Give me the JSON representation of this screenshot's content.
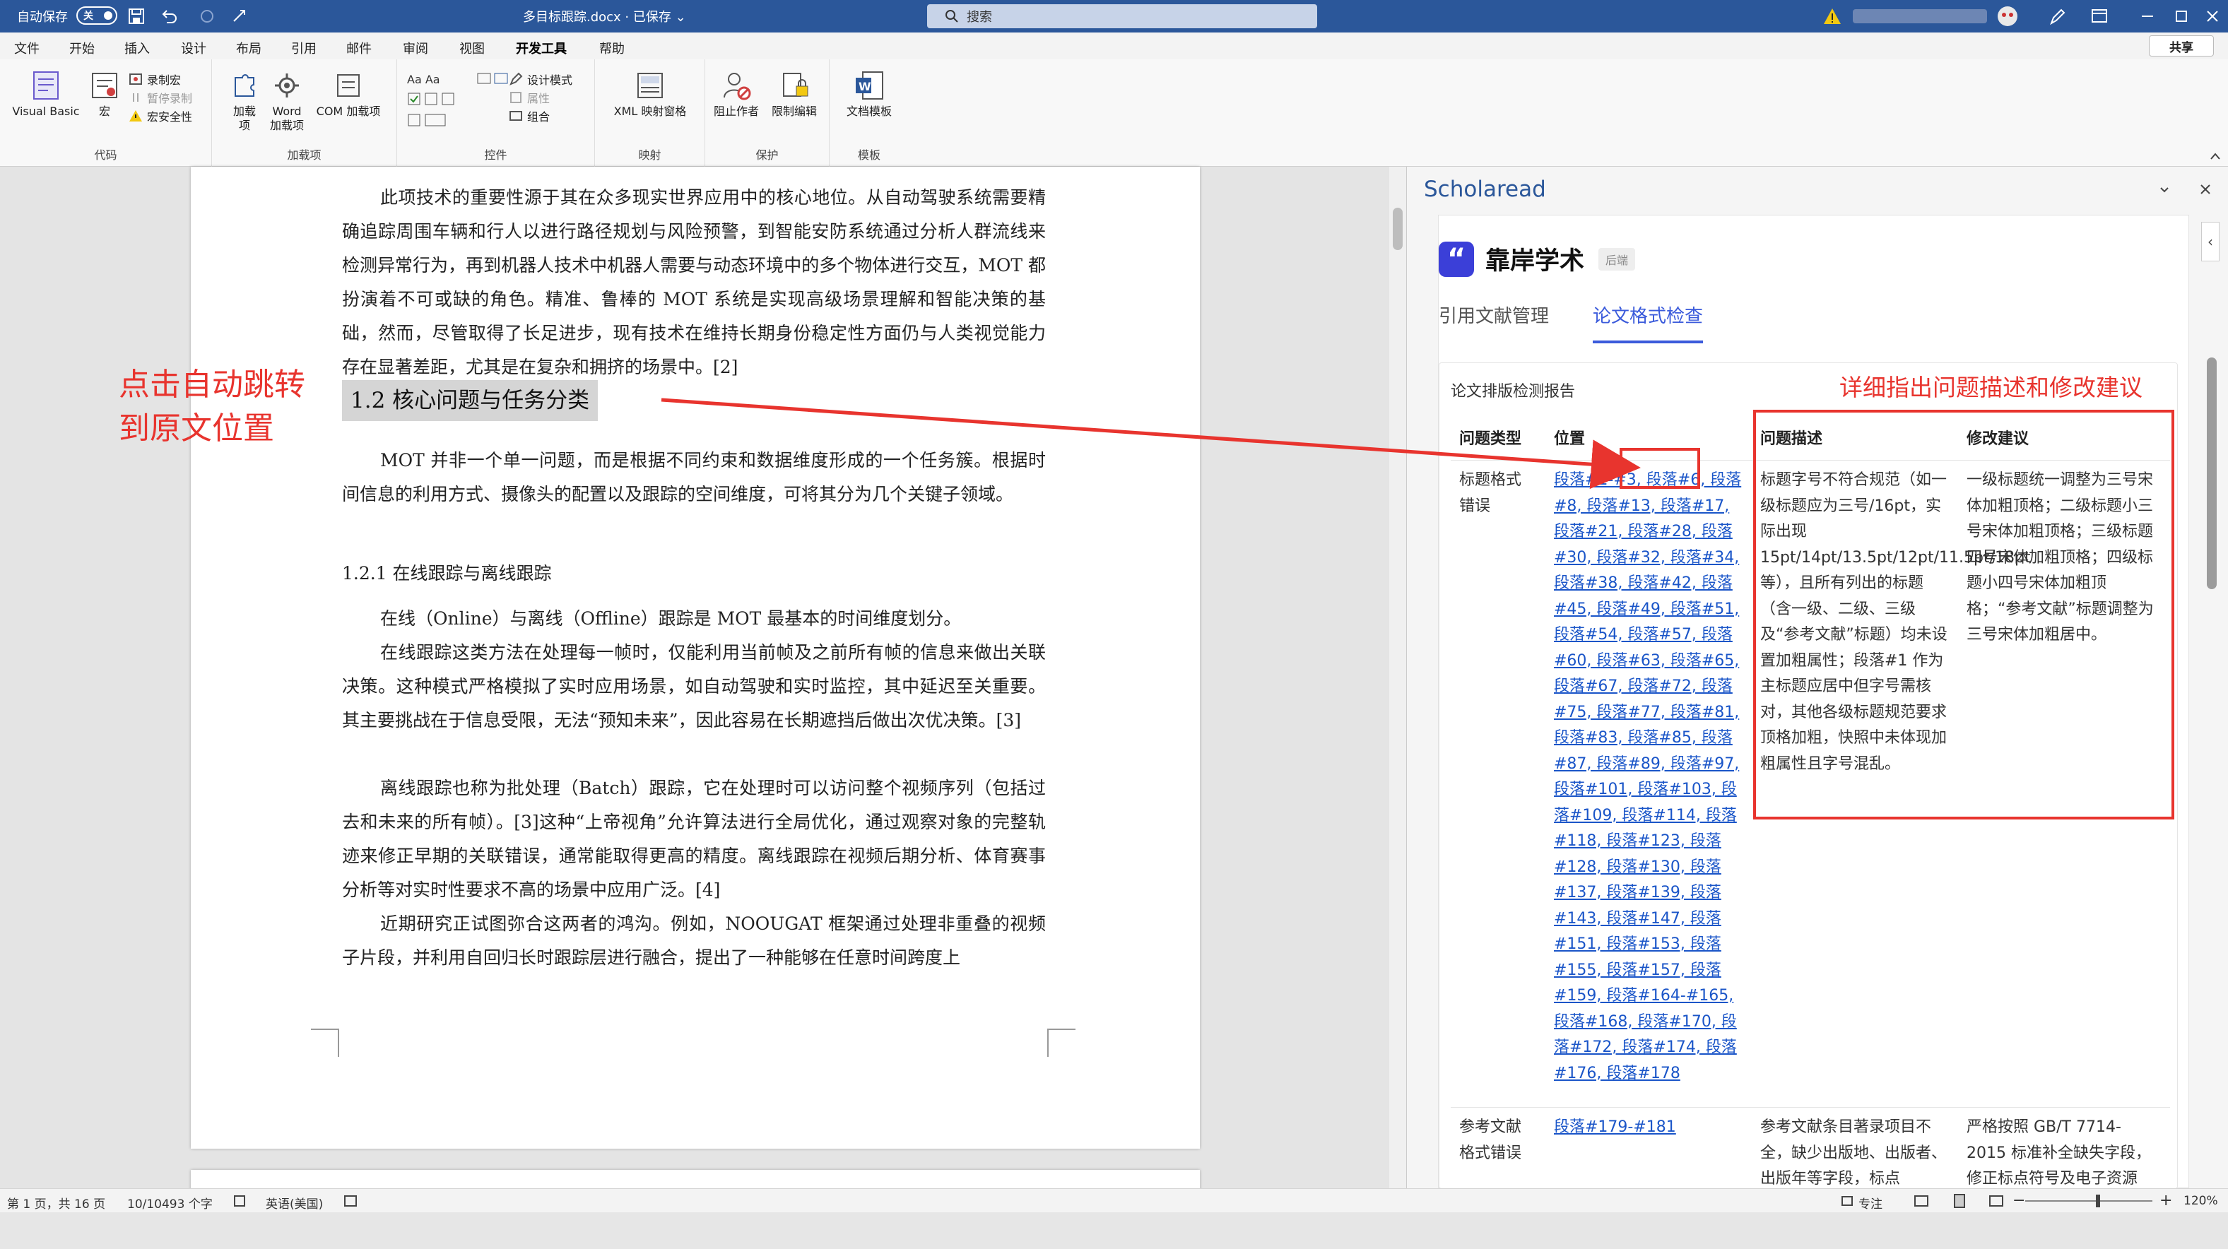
{
  "titlebar": {
    "autosave": "自动保存",
    "toggle": "关",
    "doctitle": "多目标跟踪.docx · 已保存 ⌄",
    "search_placeholder": "搜索"
  },
  "menu": {
    "tabs": [
      "文件",
      "开始",
      "插入",
      "设计",
      "布局",
      "引用",
      "邮件",
      "审阅",
      "视图",
      "开发工具",
      "帮助"
    ],
    "active": "开发工具",
    "share": "共享"
  },
  "ribbon": {
    "groups": [
      "代码",
      "加载项",
      "控件",
      "映射",
      "保护",
      "模板"
    ],
    "visual_basic": "Visual Basic",
    "macro": "宏",
    "record_macro": "录制宏",
    "pause_record": "暂停录制",
    "macro_security": "宏安全性",
    "addins": "加载项",
    "word_addins": "Word 加载项",
    "com_addins": "COM 加载项",
    "design_mode": "设计模式",
    "properties": "属性",
    "group": "组合",
    "xml_pane": "XML 映射窗格",
    "block_authors": "阻止作者",
    "restrict_edit": "限制编辑",
    "doc_template": "文档模板"
  },
  "document": {
    "para1": "此项技术的重要性源于其在众多现实世界应用中的核心地位。从自动驾驶系统需要精确追踪周围车辆和行人以进行路径规划与风险预警，到智能安防系统通过分析人群流线来检测异常行为，再到机器人技术中机器人需要与动态环境中的多个物体进行交互，MOT 都扮演着不可或缺的角色。精准、鲁棒的 MOT 系统是实现高级场景理解和智能决策的基础，然而，尽管取得了长足进步，现有技术在维持长期身份稳定性方面仍与人类视觉能力存在显著差距，尤其是在复杂和拥挤的场景中。[2]",
    "heading": "1.2  核心问题与任务分类",
    "para2": "MOT 并非一个单一问题，而是根据不同约束和数据维度形成的一个任务簇。根据时间信息的利用方式、摄像头的配置以及跟踪的空间维度，可将其分为几个关键子领域。",
    "sub": "1.2.1  在线跟踪与离线跟踪",
    "para3": "在线（Online）与离线（Offline）跟踪是 MOT 最基本的时间维度划分。",
    "para4": "在线跟踪这类方法在处理每一帧时，仅能利用当前帧及之前所有帧的信息来做出关联决策。这种模式严格模拟了实时应用场景，如自动驾驶和实时监控，其中延迟至关重要。其主要挑战在于信息受限，无法“预知未来”，因此容易在长期遮挡后做出次优决策。[3]",
    "para5": "离线跟踪也称为批处理（Batch）跟踪，它在处理时可以访问整个视频序列（包括过去和未来的所有帧）。[3]这种“上帝视角”允许算法进行全局优化，通过观察对象的完整轨迹来修正早期的关联错误，通常能取得更高的精度。离线跟踪在视频后期分析、体育赛事分析等对实时性要求不高的场景中应用广泛。[4]",
    "para6": "近期研究正试图弥合这两者的鸿沟。例如，NOOUGAT 框架通过处理非重叠的视频子片段，并利用自回归长时跟踪层进行融合，提出了一种能够在任意时间跨度上",
    "callout": "点击自动跳转到原文位置"
  },
  "pane": {
    "title": "Scholaread",
    "logo_text": "靠岸学术",
    "logo_glyph": "“",
    "badge": "后端",
    "tabs": [
      "引用文献管理",
      "论文格式检查"
    ],
    "active_tab": "论文格式检查",
    "report_name": "论文排版检测报告",
    "annotation": "详细指出问题描述和修改建议",
    "columns": [
      "问题类型",
      "位置",
      "问题描述",
      "修改建议"
    ],
    "rows": [
      {
        "type": "标题格式错误",
        "location": "段落#1-#3, 段落#6, 段落#8, 段落#13, 段落#17, 段落#21, 段落#28, 段落#30, 段落#32, 段落#34, 段落#38, 段落#42, 段落#45, 段落#49, 段落#51, 段落#54, 段落#57, 段落#60, 段落#63, 段落#65, 段落#67, 段落#72, 段落#75, 段落#77, 段落#81, 段落#83, 段落#85, 段落#87, 段落#89, 段落#97, 段落#101, 段落#103, 段落#109, 段落#114, 段落#118, 段落#123, 段落#128, 段落#130, 段落#137, 段落#139, 段落#143, 段落#147, 段落#151, 段落#153, 段落#155, 段落#157, 段落#159, 段落#164-#165, 段落#168, 段落#170, 段落#172, 段落#174, 段落#176, 段落#178",
        "desc": "标题字号不符合规范（如一级标题应为三号/16pt，实际出现15pt/14pt/13.5pt/12pt/11.5pt/18pt 等），且所有列出的标题（含一级、二级、三级及“参考文献”标题）均未设置加粗属性；段落#1 作为主标题应居中但字号需核对，其他各级标题规范要求顶格加粗，快照中未体现加粗属性且字号混乱。",
        "suggest": "一级标题统一调整为三号宋体加粗顶格；二级标题小三号宋体加粗顶格；三级标题四号宋体加粗顶格；四级标题小四号宋体加粗顶格；“参考文献”标题调整为三号宋体加粗居中。"
      },
      {
        "type": "参考文献格式错误",
        "location": "段落#179-#181",
        "desc": "参考文献条目著录项目不全，缺少出版地、出版者、出版年等字段，标点",
        "suggest": "严格按照 GB/T 7714-2015 标准补全缺失字段，修正标点符号及电子资源"
      }
    ]
  },
  "status": {
    "page": "第 1 页，共 16 页",
    "words": "10/10493 个字",
    "lang": "英语(美国)",
    "focus": "专注",
    "zoom": "120%"
  }
}
